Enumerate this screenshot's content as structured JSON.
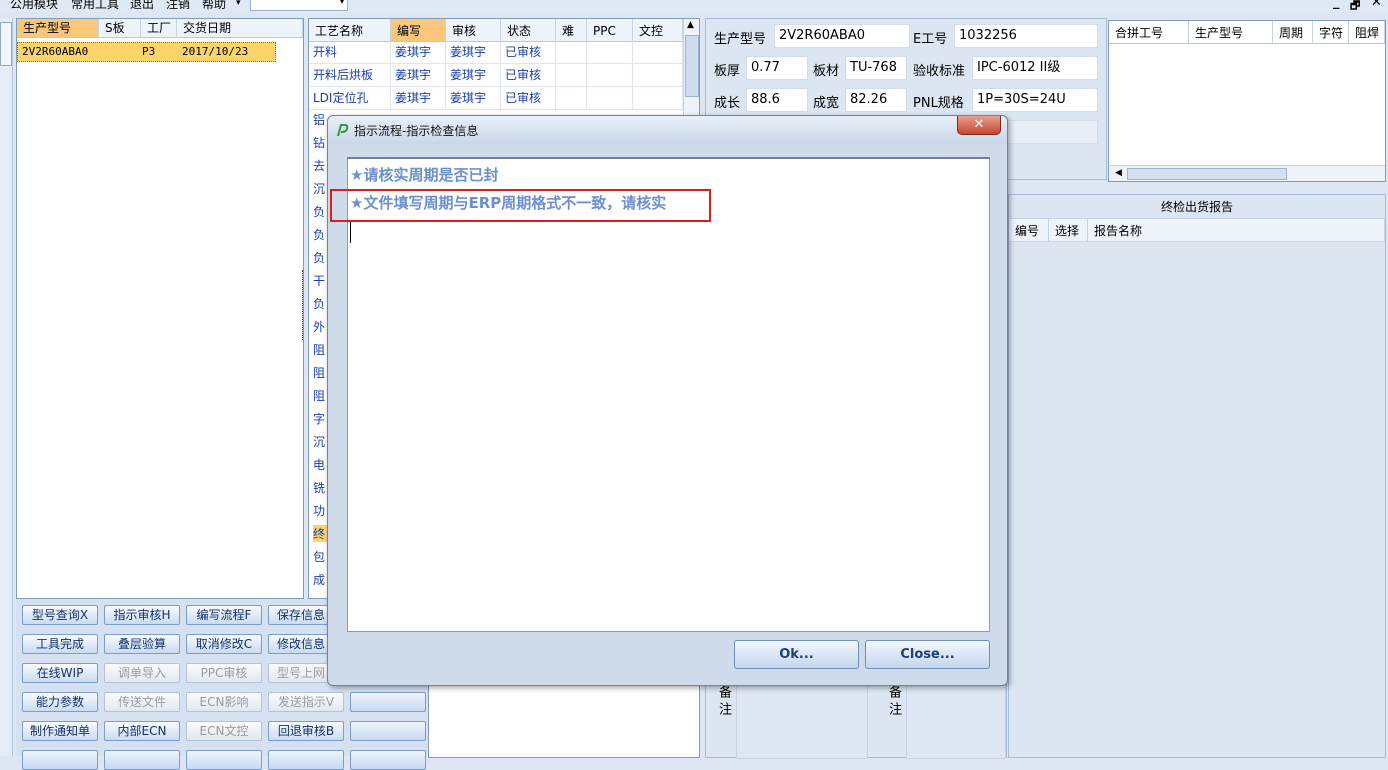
{
  "menubar": {
    "items": [
      "公用模块",
      "常用工具",
      "退出",
      "注销",
      "帮助"
    ],
    "help_arrow": "▾",
    "combo_arrow": "▾",
    "window_controls": [
      "_",
      "🗗",
      "✕"
    ]
  },
  "model_grid": {
    "columns": [
      "生产型号",
      "S板",
      "工厂",
      "交货日期"
    ],
    "rows": [
      [
        "2V2R60ABA0",
        "",
        "P3",
        "2017/10/23"
      ]
    ]
  },
  "process_grid": {
    "columns": [
      "工艺名称",
      "编写",
      "审核",
      "状态",
      "难",
      "PPC",
      "文控"
    ],
    "rows": [
      [
        "开料",
        "姜琪宇",
        "姜琪宇",
        "已审核"
      ],
      [
        "开料后烘板",
        "姜琪宇",
        "姜琪宇",
        "已审核"
      ],
      [
        "LDI定位孔",
        "姜琪宇",
        "姜琪宇",
        "已审核"
      ]
    ],
    "partial_rows": [
      "铝",
      "钻",
      "去",
      "沉",
      "负",
      "负",
      "负",
      "干",
      "负",
      "外",
      "阻",
      "阻",
      "阻",
      "字",
      "沉",
      "电",
      "铣",
      "功",
      "终",
      "包",
      "成"
    ],
    "scroll_up": "▲"
  },
  "buttons": {
    "col1": [
      "型号查询X",
      "工具完成",
      "在线WIP",
      "能力参数",
      "制作通知单"
    ],
    "col2": [
      "指示审核H",
      "叠层验算",
      "调单导入",
      "传送文件",
      "内部ECN"
    ],
    "col3": [
      "编写流程F",
      "取消修改C",
      "PPC审核",
      "ECN影响",
      "ECN文控"
    ],
    "col4": [
      "保存信息",
      "修改信息",
      "型号上网",
      "发送指示V",
      "回退审核B"
    ]
  },
  "product_info": {
    "model_label": "生产型号",
    "model_value": "2V2R60ABA0",
    "ework_label": "E工号",
    "ework_value": "1032256",
    "thickness_label": "板厚",
    "thickness_value": "0.77",
    "material_label": "板材",
    "material_value": "TU-768",
    "standard_label": "验收标准",
    "standard_value": "IPC-6012 II级",
    "length_label": "成长",
    "length_value": "88.6",
    "width_label": "成宽",
    "width_value": "82.26",
    "pnl_label": "PNL规格",
    "pnl_value": "1P=30S=24U"
  },
  "merge_grid": {
    "columns": [
      "合拼工号",
      "生产型号",
      "周期",
      "字符",
      "阻焊"
    ],
    "scroll_left": "◀"
  },
  "report_grid": {
    "title": "终检出货报告",
    "columns": [
      "编号",
      "选择",
      "报告名称"
    ]
  },
  "remarks": {
    "label_left": "备注",
    "label_right": "备注"
  },
  "dialog": {
    "title": "指示流程-指示检查信息",
    "close_glyph": "✕",
    "messages": [
      "★请核实周期是否已封",
      "★文件填写周期与ERP周期格式不一致，请核实"
    ],
    "ok_label": "Ok...",
    "close_label": "Close..."
  }
}
